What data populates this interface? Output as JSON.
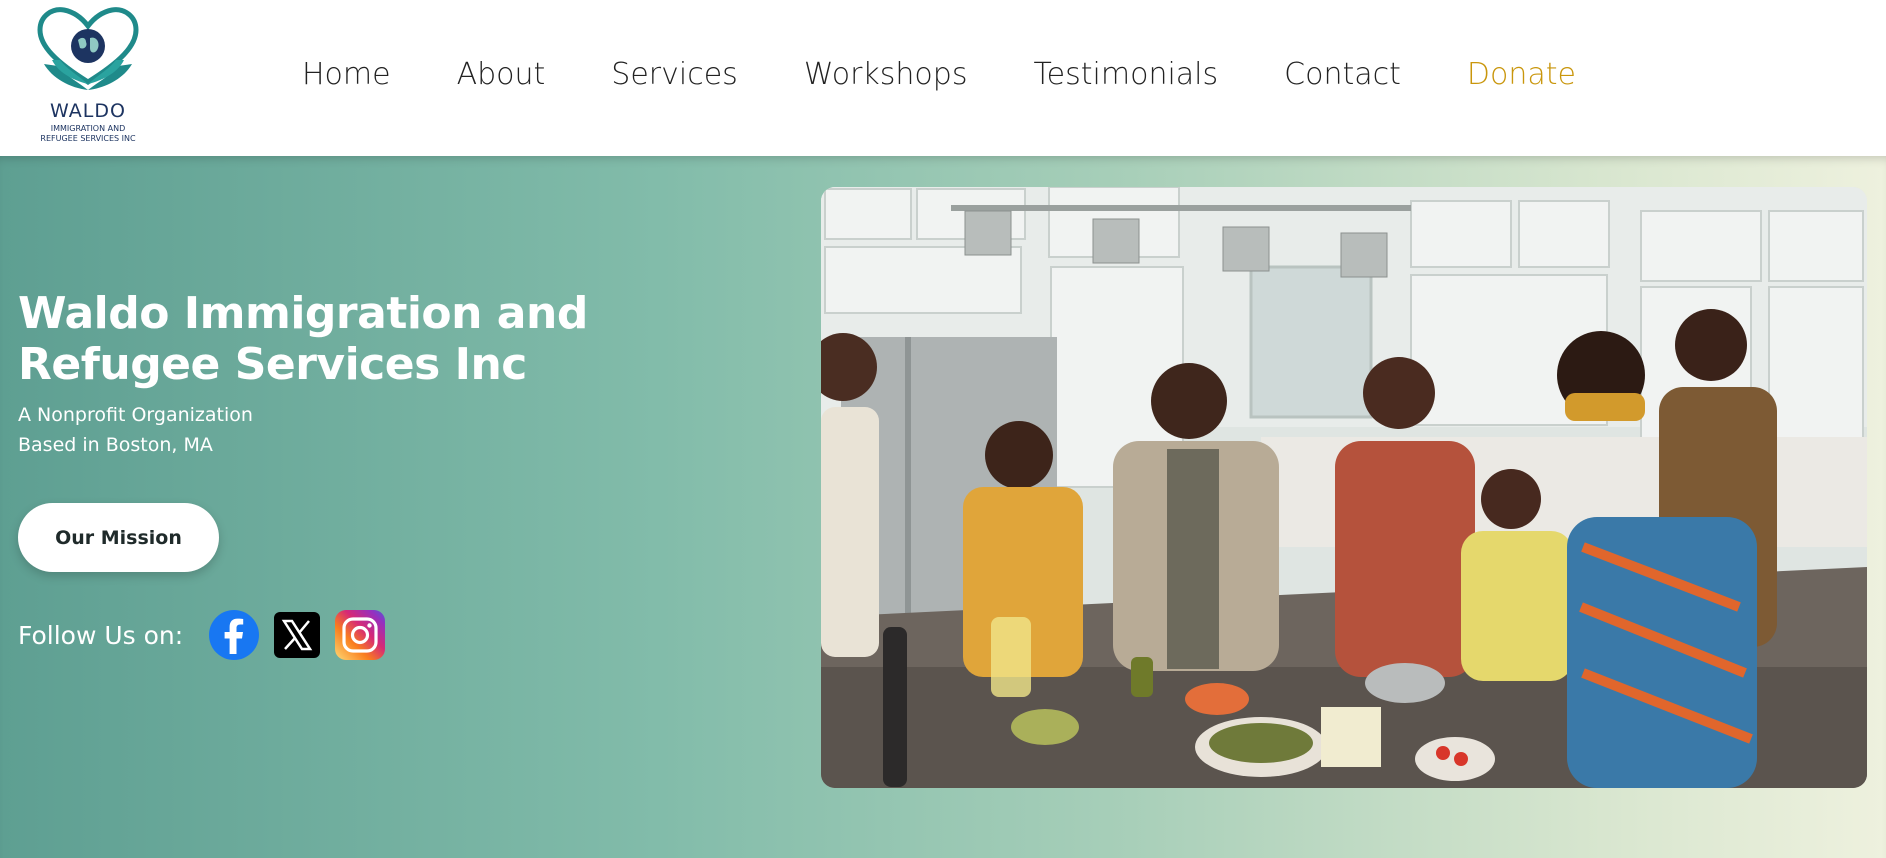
{
  "header": {
    "logo": {
      "name": "WALDO",
      "subtitle_line1": "IMMIGRATION AND",
      "subtitle_line2": "REFUGEE SERVICES INC",
      "icon": "heart-globe-hands-logo"
    },
    "nav": [
      {
        "label": "Home"
      },
      {
        "label": "About"
      },
      {
        "label": "Services"
      },
      {
        "label": "Workshops"
      },
      {
        "label": "Testimonials"
      },
      {
        "label": "Contact"
      },
      {
        "label": "Donate"
      }
    ]
  },
  "hero": {
    "title_line1": "Waldo Immigration and",
    "title_line2": "Refugee Services Inc",
    "subtitle_line1": "A Nonprofit Organization",
    "subtitle_line2": "Based in Boston, MA",
    "mission_button": "Our Mission",
    "follow_label": "Follow Us on:",
    "social": [
      "facebook-icon",
      "x-icon",
      "instagram-icon"
    ],
    "photo": "family-cooking-in-kitchen-photo"
  },
  "colors": {
    "teal": "#5e9f92",
    "donate": "#c9960c",
    "logo_blue": "#1d3461"
  }
}
